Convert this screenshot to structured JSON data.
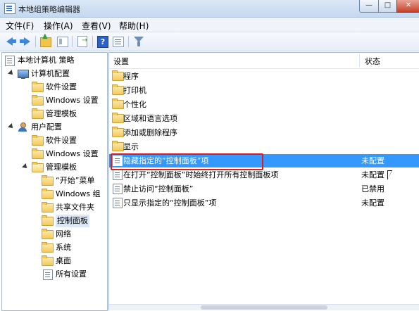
{
  "window": {
    "title": "本地组策略编辑器",
    "min_label": "—",
    "max_label": "□",
    "close_label": "✕"
  },
  "menu": [
    "文件(F)",
    "操作(A)",
    "查看(V)",
    "帮助(H)"
  ],
  "tree": {
    "root": "本地计算机 策略",
    "computer_config": "计算机配置",
    "cc_children": [
      "软件设置",
      "Windows 设置",
      "管理模板"
    ],
    "user_config": "用户配置",
    "uc_children": [
      "软件设置",
      "Windows 设置",
      "管理模板"
    ],
    "at_children": [
      "“开始”菜单",
      "Windows 组",
      "共享文件夹",
      "控制面板",
      "网络",
      "系统",
      "桌面",
      "所有设置"
    ]
  },
  "list": {
    "col_setting": "设置",
    "col_status": "状态",
    "folders": [
      "程序",
      "打印机",
      "个性化",
      "区域和语言选项",
      "添加或删除程序",
      "显示"
    ],
    "policies": [
      {
        "name": "隐藏指定的“控制面板”项",
        "state": "未配置",
        "selected": true
      },
      {
        "name": "在打开“控制面板”时始终打开所有控制面板项",
        "state": "未配置"
      },
      {
        "name": "禁止访问“控制面板”",
        "state": "已禁用"
      },
      {
        "name": "只显示指定的“控制面板”项",
        "state": "未配置"
      }
    ]
  },
  "colors": {
    "selection": "#3399ff",
    "highlight_box": "#e11a1a"
  }
}
